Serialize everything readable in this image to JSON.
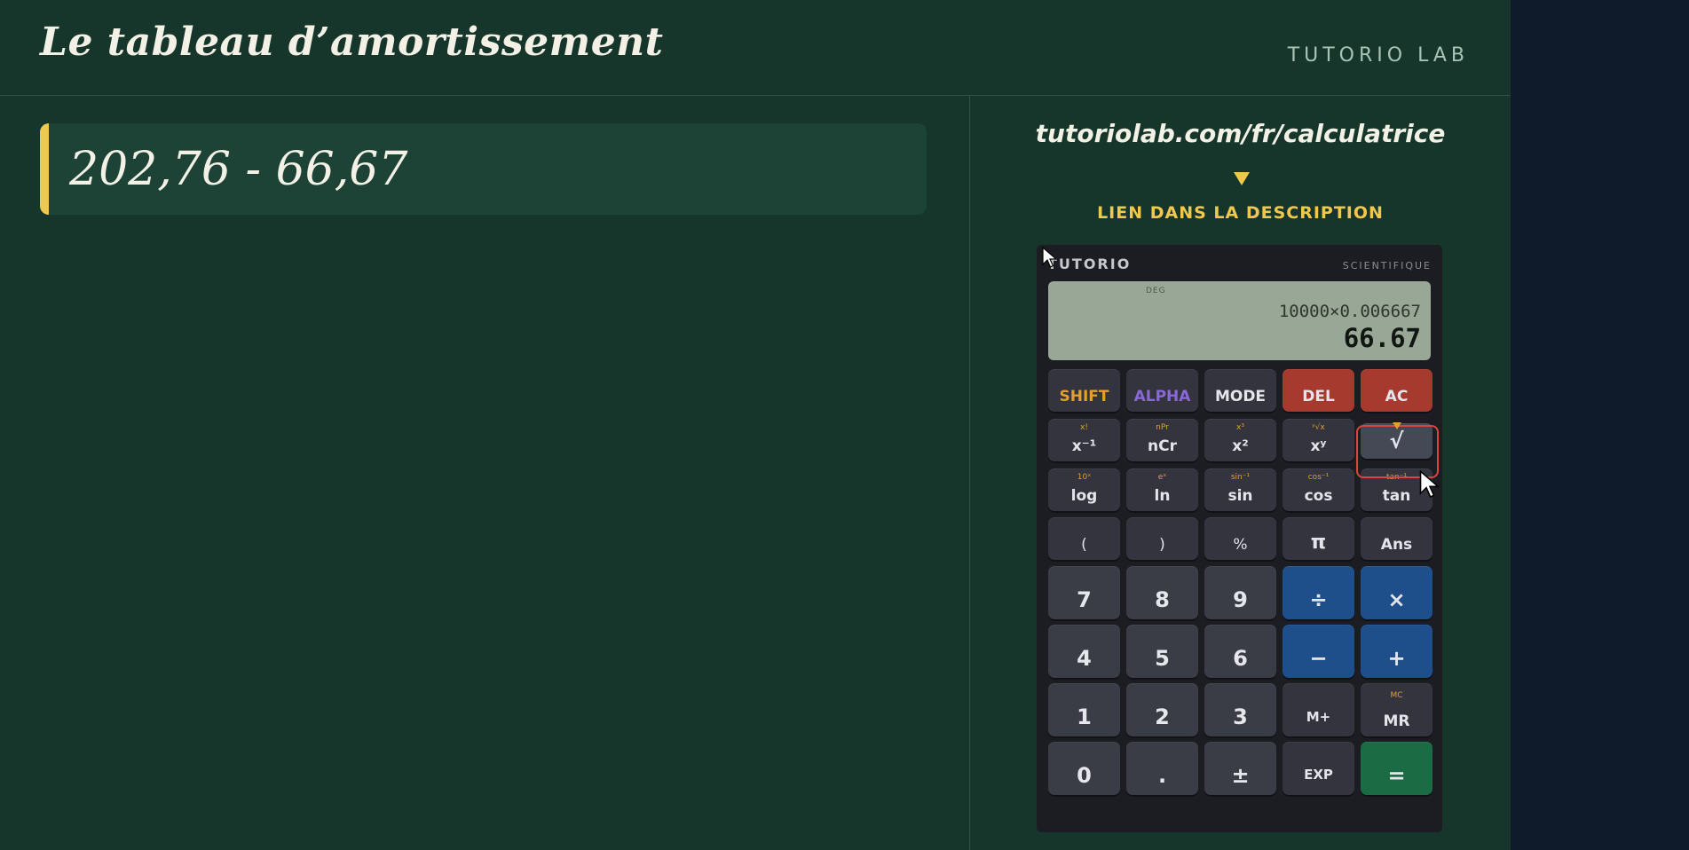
{
  "header": {
    "title": "Le tableau d’amortissement",
    "brand": "TUTORIO LAB"
  },
  "expression": "202,76 - 66,67",
  "promo": {
    "url": "tutoriolab.com/fr/calculatrice",
    "note": "LIEN DANS LA DESCRIPTION"
  },
  "calculator": {
    "brand": "TUTORIO",
    "mode": "SCIENTIFIQUE",
    "screen": {
      "indicator": "DEG",
      "expression": "10000×0.006667",
      "result": "66.67"
    },
    "keys": {
      "shift": "SHIFT",
      "alpha": "ALPHA",
      "mode": "MODE",
      "del": "DEL",
      "ac": "AC",
      "x_inv": "x⁻¹",
      "x_inv_sub": "x!",
      "ncr": "nCr",
      "ncr_sub": "nPr",
      "x_sq": "x²",
      "x_sq_sub": "x³",
      "x_pow": "xʸ",
      "x_pow_sub": "ʸ√x",
      "sqrt": "√",
      "log": "log",
      "log_sub": "10ˣ",
      "ln": "ln",
      "ln_sub": "eˣ",
      "sin": "sin",
      "sin_sub": "sin⁻¹",
      "cos": "cos",
      "cos_sub": "cos⁻¹",
      "tan": "tan",
      "tan_sub": "tan⁻¹",
      "lparen": "(",
      "rparen": ")",
      "percent": "%",
      "pi": "π",
      "ans": "Ans",
      "n7": "7",
      "n8": "8",
      "n9": "9",
      "divide": "÷",
      "multiply": "×",
      "n4": "4",
      "n5": "5",
      "n6": "6",
      "minus": "−",
      "plus": "+",
      "n1": "1",
      "n2": "2",
      "n3": "3",
      "mplus": "M+",
      "mr": "MR",
      "mr_sub": "MC",
      "n0": "0",
      "dot": ".",
      "plusminus": "±",
      "exp": "EXP",
      "equals": "="
    }
  },
  "colors": {
    "background": "#16362b",
    "accent": "#f0c84d",
    "operator_key": "#1f4f8a",
    "danger_key": "#a63a2f",
    "equals_key": "#1b6b45",
    "highlight": "#d9463f"
  }
}
